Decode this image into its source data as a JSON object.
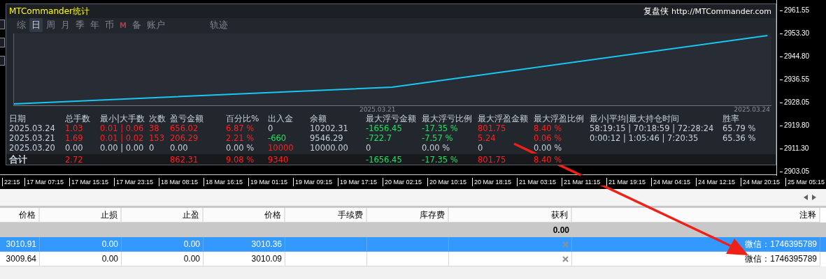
{
  "stats_panel": {
    "title": "MTCommander统计",
    "brand": "复盘侠",
    "url": "http://MTCommander.com",
    "tabs": [
      {
        "label": "综",
        "selected": false
      },
      {
        "label": "日",
        "selected": true
      },
      {
        "label": "周",
        "selected": false
      },
      {
        "label": "月",
        "selected": false
      },
      {
        "label": "季",
        "selected": false
      },
      {
        "label": "年",
        "selected": false
      },
      {
        "label": "币",
        "selected": false
      },
      {
        "label": "M",
        "selected": false
      },
      {
        "label": "备",
        "selected": false
      },
      {
        "label": "账户",
        "selected": false
      },
      {
        "label": "轨迹",
        "selected": false
      }
    ],
    "chart_dates": [
      "2025.03.21",
      "2025.03.24"
    ],
    "columns": [
      "日期",
      "总手数",
      "最小|大手数",
      "次数",
      "盈亏金额",
      "百分比%",
      "出入金",
      "余额",
      "最大浮亏金额",
      "最大浮亏比例",
      "最大浮盈金额",
      "最大浮盈比例",
      "最小|平均|最大持仓时间",
      "胜率"
    ],
    "rows": [
      {
        "kind": "day",
        "cells": [
          {
            "text": "2025.03.24",
            "color": "#c8d0dc"
          },
          {
            "text": "1.03",
            "color": "#ff2020"
          },
          {
            "text": "0.01 | 0.06",
            "color": "#ff2020"
          },
          {
            "text": "38",
            "color": "#ff2020"
          },
          {
            "text": "656.02",
            "color": "#ff2020"
          },
          {
            "text": "6.87 %",
            "color": "#ff2020"
          },
          {
            "text": "0",
            "color": "#c8d0dc"
          },
          {
            "text": "10202.31",
            "color": "#c8d0dc"
          },
          {
            "text": "-1656.45",
            "color": "#22e060"
          },
          {
            "text": "-17.35 %",
            "color": "#22e060"
          },
          {
            "text": "801.75",
            "color": "#ff2020"
          },
          {
            "text": "8.40 %",
            "color": "#ff2020"
          },
          {
            "text": "58:19:15 | 70:18:59 | 72:28:24",
            "color": "#c8d0dc"
          },
          {
            "text": "65.79 %",
            "color": "#c8d0dc"
          }
        ]
      },
      {
        "kind": "day",
        "cells": [
          {
            "text": "2025.03.21",
            "color": "#c8d0dc"
          },
          {
            "text": "1.69",
            "color": "#ff2020"
          },
          {
            "text": "0.01 | 0.02",
            "color": "#ff2020"
          },
          {
            "text": "153",
            "color": "#ff2020"
          },
          {
            "text": "206.29",
            "color": "#ff2020"
          },
          {
            "text": "2.21 %",
            "color": "#ff2020"
          },
          {
            "text": "-660",
            "color": "#22e060"
          },
          {
            "text": "9546.29",
            "color": "#c8d0dc"
          },
          {
            "text": "-722.7",
            "color": "#22e060"
          },
          {
            "text": "-7.57 %",
            "color": "#22e060"
          },
          {
            "text": "5.24",
            "color": "#ff2020"
          },
          {
            "text": "0.06 %",
            "color": "#ff2020"
          },
          {
            "text": "0:00:12 | 1:05:46 | 7:20:35",
            "color": "#c8d0dc"
          },
          {
            "text": "65.36 %",
            "color": "#c8d0dc"
          }
        ]
      },
      {
        "kind": "day",
        "cells": [
          {
            "text": "2025.03.20",
            "color": "#c8d0dc"
          },
          {
            "text": "0.00",
            "color": "#c8d0dc"
          },
          {
            "text": "0.00 | 0.00",
            "color": "#c8d0dc"
          },
          {
            "text": "0",
            "color": "#c8d0dc"
          },
          {
            "text": "0.00",
            "color": "#c8d0dc"
          },
          {
            "text": "0.00 %",
            "color": "#c8d0dc"
          },
          {
            "text": "10000",
            "color": "#ff2020"
          },
          {
            "text": "10000.00",
            "color": "#c8d0dc"
          },
          {
            "text": "0",
            "color": "#c8d0dc"
          },
          {
            "text": "0.00 %",
            "color": "#c8d0dc"
          },
          {
            "text": "0",
            "color": "#c8d0dc"
          },
          {
            "text": "0.00 %",
            "color": "#c8d0dc"
          },
          null,
          null
        ]
      },
      {
        "kind": "total",
        "cells": [
          {
            "text": "合计",
            "color": "#c8d0dc"
          },
          {
            "text": "2.72",
            "color": "#ff2020"
          },
          null,
          null,
          {
            "text": "862.31",
            "color": "#ff2020"
          },
          {
            "text": "9.08 %",
            "color": "#ff2020"
          },
          {
            "text": "9340",
            "color": "#ff2020"
          },
          null,
          {
            "text": "-1656.45",
            "color": "#22e060"
          },
          {
            "text": "-17.35 %",
            "color": "#22e060"
          },
          {
            "text": "801.75",
            "color": "#ff2020"
          },
          {
            "text": "8.40 %",
            "color": "#ff2020"
          },
          null,
          null
        ]
      }
    ]
  },
  "price_axis": [
    "2961.55",
    "2953.30",
    "2944.80",
    "2936.55",
    "2928.05",
    "2919.80",
    "2911.30",
    "2903.05"
  ],
  "time_axis": [
    "22:15",
    "17 Mar 07:15",
    "17 Mar 15:15",
    "17 Mar 23:15",
    "18 Mar 08:15",
    "18 Mar 16:15",
    "19 Mar 01:15",
    "19 Mar 09:15",
    "19 Mar 17:15",
    "20 Mar 02:15",
    "20 Mar 10:15",
    "20 Mar 18:15",
    "21 Mar 03:15",
    "21 Mar 11:15",
    "21 Mar 19:15",
    "24 Mar 04:15",
    "24 Mar 12:15",
    "24 Mar 20:15",
    "25 Mar 05:15"
  ],
  "trade_table": {
    "columns": [
      "价格",
      "止损",
      "止盈",
      "价格",
      "手续费",
      "库存费",
      "获利",
      "注释"
    ],
    "summary_profit": "0.00",
    "rows": [
      {
        "selected": true,
        "cells": [
          "3010.91",
          "0.00",
          "0.00",
          "3010.36"
        ],
        "comment": "微信：1746395789"
      },
      {
        "selected": false,
        "cells": [
          "3009.64",
          "0.00",
          "0.00",
          "3010.09"
        ],
        "comment": "微信：1746395789"
      }
    ]
  }
}
